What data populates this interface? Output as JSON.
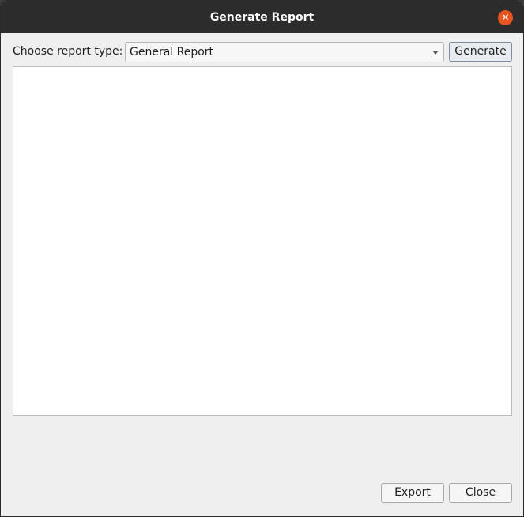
{
  "window": {
    "title": "Generate Report",
    "close_glyph": "✕"
  },
  "form": {
    "type_label": "Choose report type:",
    "report_type": "General Report",
    "generate_label": "Generate"
  },
  "report": {
    "content": ""
  },
  "footer": {
    "export_label": "Export",
    "close_label": "Close"
  },
  "colors": {
    "titlebar": "#2c2c2c",
    "close_accent": "#e95420",
    "dialog_bg": "#efefef"
  },
  "icons": {
    "close": "close-icon",
    "dropdown": "chevron-down-icon"
  }
}
